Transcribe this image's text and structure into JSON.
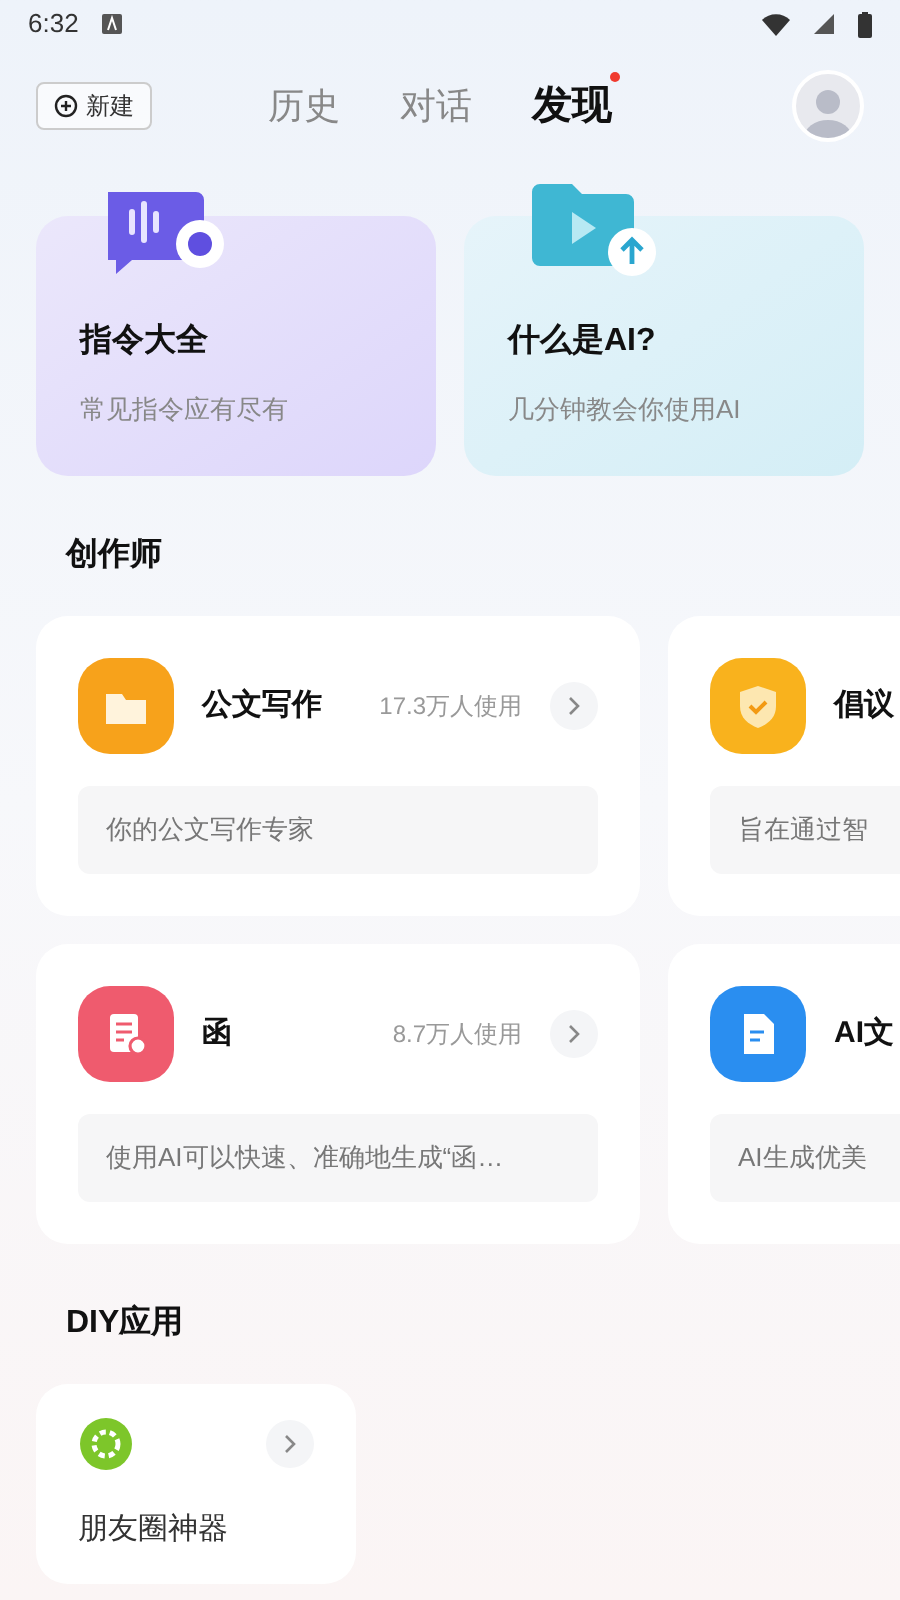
{
  "status_bar": {
    "time": "6:32"
  },
  "header": {
    "new_button": "新建",
    "tabs": [
      {
        "label": "历史",
        "selected": false,
        "badge": false
      },
      {
        "label": "对话",
        "selected": false,
        "badge": false
      },
      {
        "label": "发现",
        "selected": true,
        "badge": true
      }
    ]
  },
  "feature_cards": [
    {
      "kind": "voice",
      "title": "指令大全",
      "subtitle": "常见指令应有尽有"
    },
    {
      "kind": "video",
      "title": "什么是AI?",
      "subtitle": "几分钟教会你使用AI"
    }
  ],
  "creators": {
    "title": "创作师",
    "rows": [
      [
        {
          "kind": "folder",
          "name": "公文写作",
          "usage": "17.3万人使用",
          "description": "你的公文写作专家"
        },
        {
          "kind": "shield",
          "name": "倡议",
          "description": "旨在通过智"
        }
      ],
      [
        {
          "kind": "letter",
          "name": "函",
          "usage": "8.7万人使用",
          "description": "使用AI可以快速、准确地生成“函…"
        },
        {
          "kind": "doc",
          "name": "AI文",
          "description": "AI生成优美"
        }
      ]
    ]
  },
  "diy": {
    "title": "DIY应用",
    "apps": [
      {
        "kind": "camera",
        "name": "朋友圈神器"
      }
    ]
  }
}
